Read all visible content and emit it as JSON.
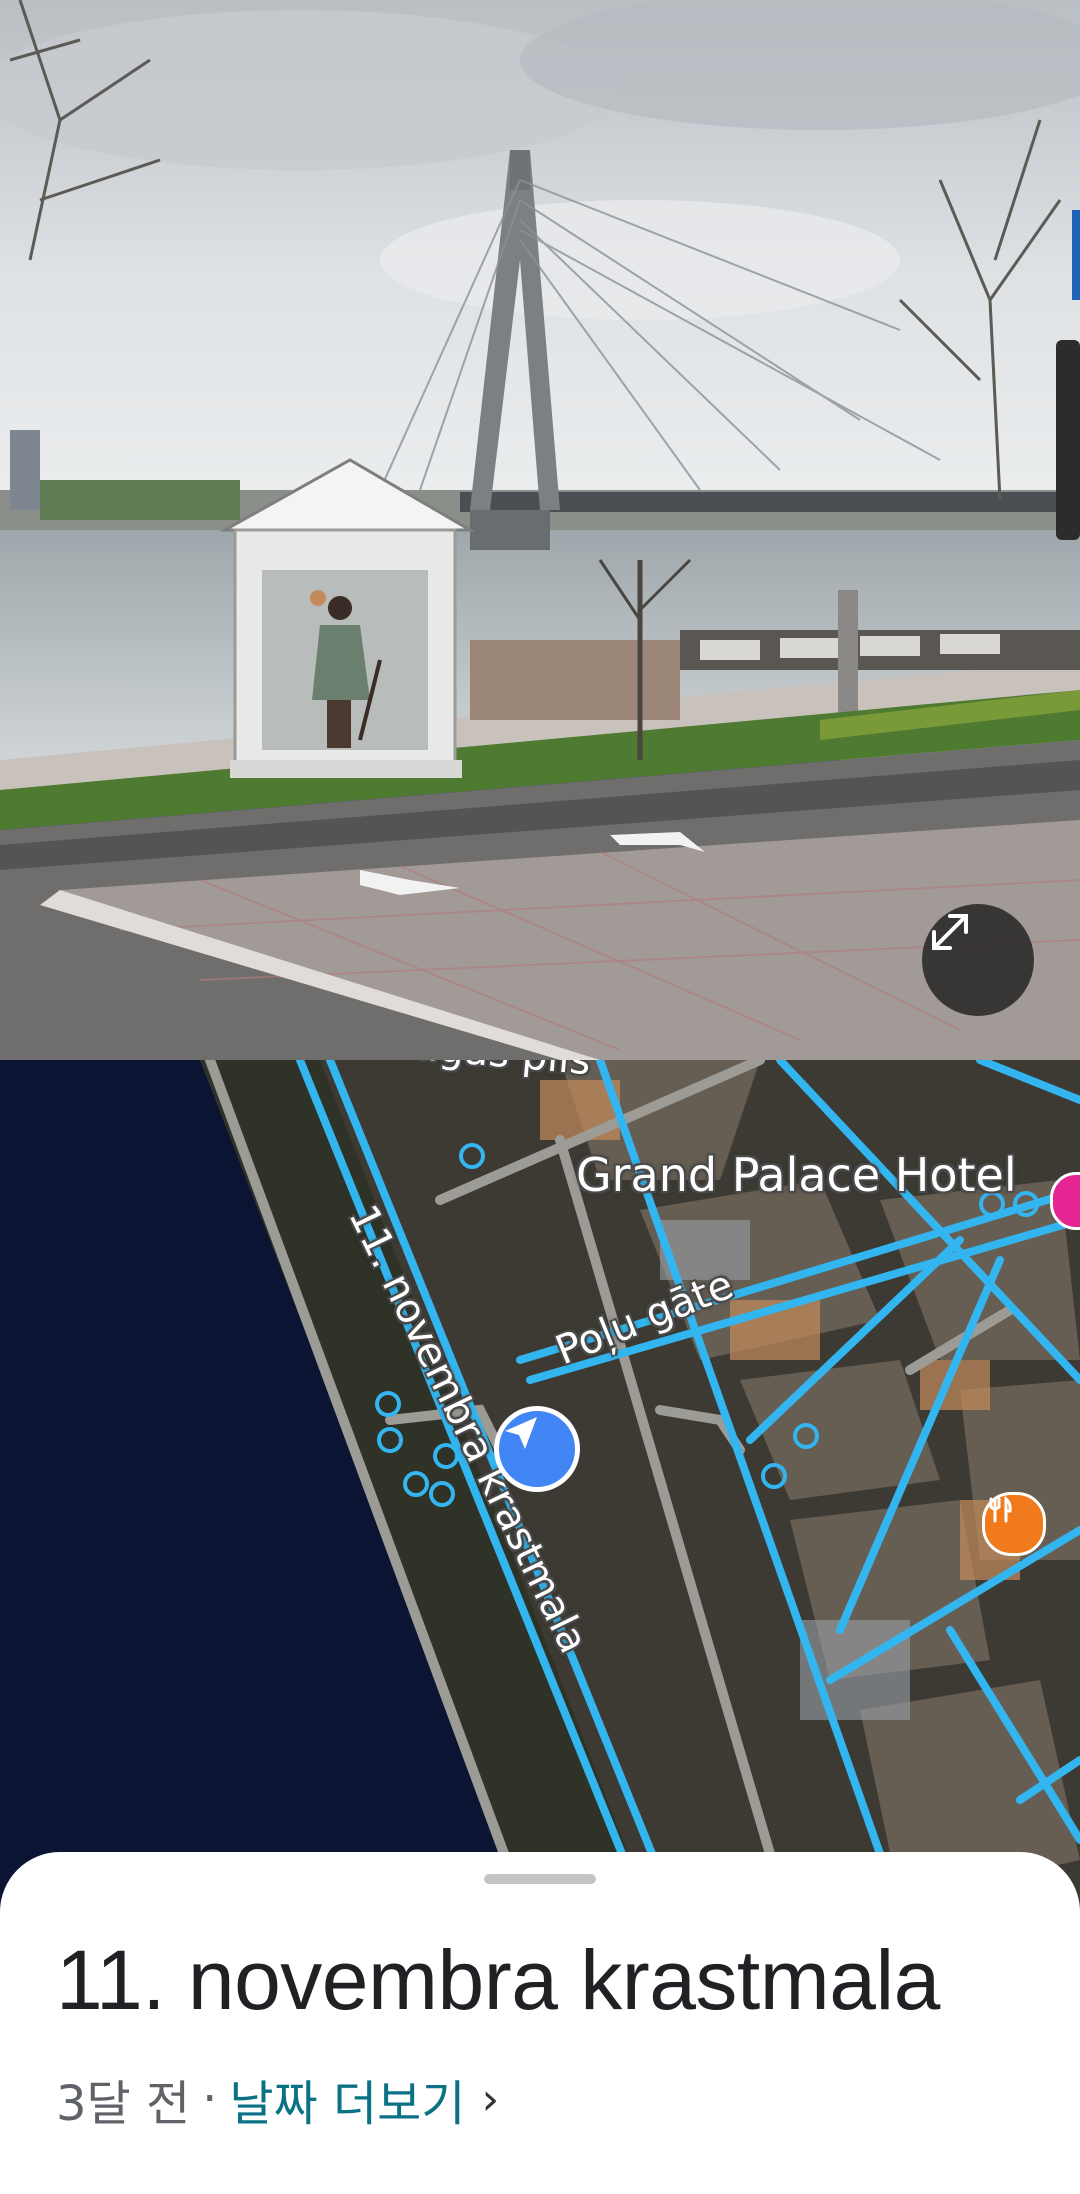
{
  "street_view": {
    "expand_icon": "fullscreen-expand-icon"
  },
  "map": {
    "labels": {
      "hotel": "Grand Palace Hotel",
      "street_side": "Poļu gāte",
      "street_main": "11. novembra krastmala",
      "top_cut": "Rīgas pils"
    },
    "icons": {
      "location": "navigation-arrow-icon",
      "restaurant": "restaurant-icon",
      "hotel": "hotel-icon"
    },
    "colors": {
      "street_view_coverage": "#33b5f0",
      "location_marker": "#4285f4",
      "restaurant": "#f07a1c",
      "hotel": "#e52592"
    }
  },
  "sheet": {
    "title": "11. novembra krastmala",
    "date_text": "3달 전",
    "separator": "·",
    "more_dates_link": "날짜 더보기",
    "chevron": "›"
  }
}
